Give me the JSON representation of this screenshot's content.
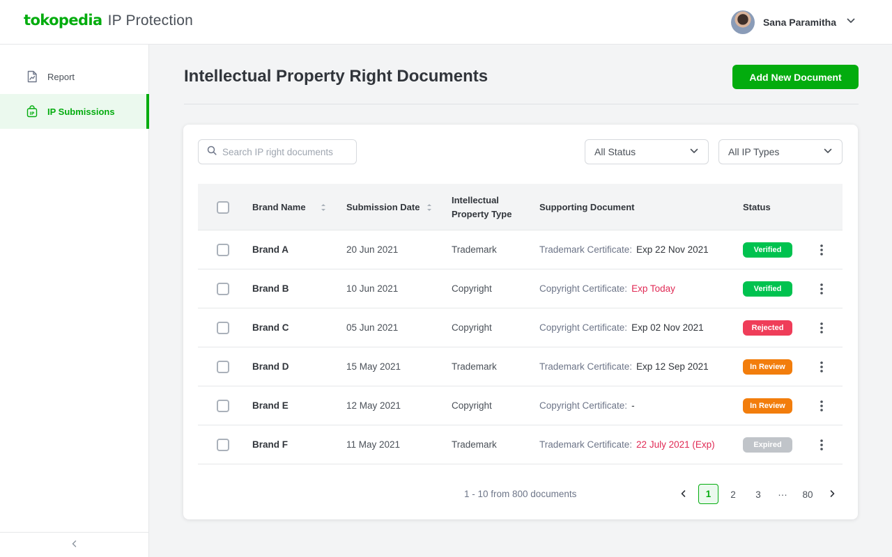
{
  "header": {
    "brand": "tokopedia",
    "product": "IP Protection",
    "user_name": "Sana Paramitha"
  },
  "sidebar": {
    "items": [
      {
        "label": "Report",
        "icon": "report-icon",
        "active": false
      },
      {
        "label": "IP Submissions",
        "icon": "ip-bag-icon",
        "active": true
      }
    ]
  },
  "main": {
    "title": "Intellectual Property Right Documents",
    "add_button": "Add New Document",
    "search_placeholder": "Search IP right documents",
    "filter_status": "All Status",
    "filter_type": "All IP Types",
    "columns": {
      "brand": "Brand Name",
      "date": "Submission Date",
      "type_line1": "Intellectual",
      "type_line2": "Property Type",
      "doc": "Supporting Document",
      "status": "Status"
    },
    "rows": [
      {
        "brand": "Brand A",
        "date": "20 Jun 2021",
        "type": "Trademark",
        "doc_label": "Trademark Certificate:",
        "doc_value": "Exp 22 Nov 2021",
        "status": "Verified"
      },
      {
        "brand": "Brand B",
        "date": "10 Jun 2021",
        "type": "Copyright",
        "doc_label": "Copyright Certificate:",
        "doc_value": "Exp Today",
        "status": "Verified"
      },
      {
        "brand": "Brand C",
        "date": "05 Jun 2021",
        "type": "Copyright",
        "doc_label": "Copyright Certificate:",
        "doc_value": "Exp 02 Nov 2021",
        "status": "Rejected"
      },
      {
        "brand": "Brand D",
        "date": "15 May 2021",
        "type": "Trademark",
        "doc_label": "Trademark Certificate:",
        "doc_value": "Exp 12 Sep 2021",
        "status": "In Review"
      },
      {
        "brand": "Brand E",
        "date": "12 May 2021",
        "type": "Copyright",
        "doc_label": "Copyright Certificate:",
        "doc_value": "-",
        "status": "In Review"
      },
      {
        "brand": "Brand F",
        "date": "11 May 2021",
        "type": "Trademark",
        "doc_label": "Trademark Certificate:",
        "doc_value": "22 July 2021 (Exp)",
        "status": "Expired"
      }
    ],
    "pagination": {
      "info": "1 - 10 from 800 documents",
      "pages": [
        "1",
        "2",
        "3",
        "···",
        "80"
      ],
      "current": "1"
    }
  },
  "colors": {
    "accent": "#03ac0e",
    "verified": "#00c24f",
    "rejected": "#ef3d59",
    "in_review": "#f27d0c",
    "expired": "#c0c4c9",
    "warning_text": "#e02954"
  }
}
